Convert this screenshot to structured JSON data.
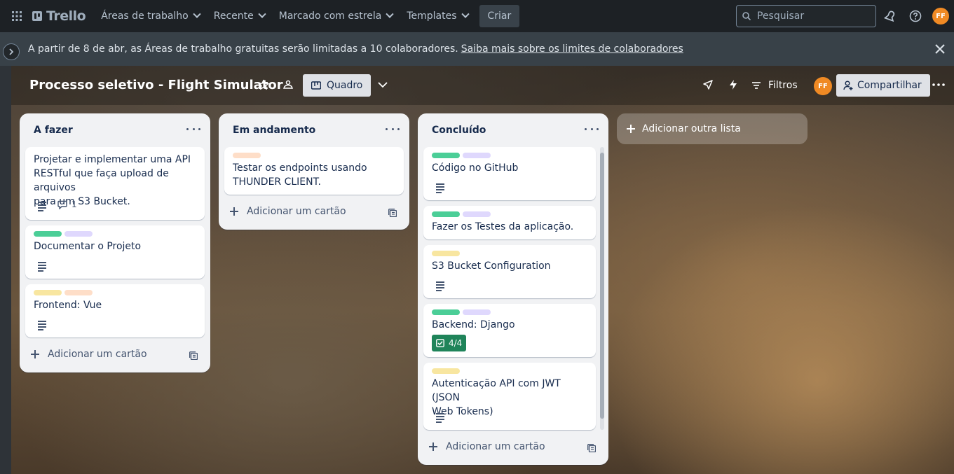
{
  "topnav": {
    "logo_text": "Trello",
    "menus": [
      "Áreas de trabalho",
      "Recente",
      "Marcado com estrela",
      "Templates"
    ],
    "create_label": "Criar",
    "search_placeholder": "Pesquisar",
    "avatar_initials": "FF"
  },
  "banner": {
    "text": "A partir de 8 de abr, as Áreas de trabalho gratuitas serão limitadas a 10 colaboradores.",
    "link": "Saiba mais sobre os limites de colaboradores"
  },
  "board": {
    "title": "Processo seletivo - Flight Simulator",
    "view_label": "Quadro",
    "filter_label": "Filtros",
    "avatar_initials": "FF",
    "share_label": "Compartilhar",
    "add_list_label": "Adicionar outra lista"
  },
  "colors": {
    "label_green": "#4bce97",
    "label_purple": "#dfd8fd",
    "label_orange": "#fedec8",
    "label_yellow": "#f8e6a0",
    "checklist_green": "#1f845a"
  },
  "lists": [
    {
      "title": "A fazer",
      "add_card_label": "Adicionar um cartão",
      "cards": [
        {
          "title_lines": [
            "Projetar e implementar uma API",
            "RESTful que faça upload de arquivos",
            "para um S3 Bucket."
          ],
          "comments": "1"
        },
        {
          "title": "Documentar o Projeto"
        },
        {
          "title": "Frontend: Vue"
        }
      ]
    },
    {
      "title": "Em andamento",
      "add_card_label": "Adicionar um cartão",
      "cards": [
        {
          "title_lines": [
            "Testar os endpoints usando",
            "THUNDER CLIENT."
          ]
        }
      ]
    },
    {
      "title": "Concluído",
      "add_card_label": "Adicionar um cartão",
      "cards": [
        {
          "title": "Código no GitHub"
        },
        {
          "title": "Fazer os Testes da aplicação."
        },
        {
          "title": "S3 Bucket Configuration"
        },
        {
          "title": "Backend: Django",
          "checklist": "4/4"
        },
        {
          "title_lines": [
            "Autenticação API com JWT (JSON",
            "Web Tokens)"
          ]
        }
      ]
    }
  ]
}
